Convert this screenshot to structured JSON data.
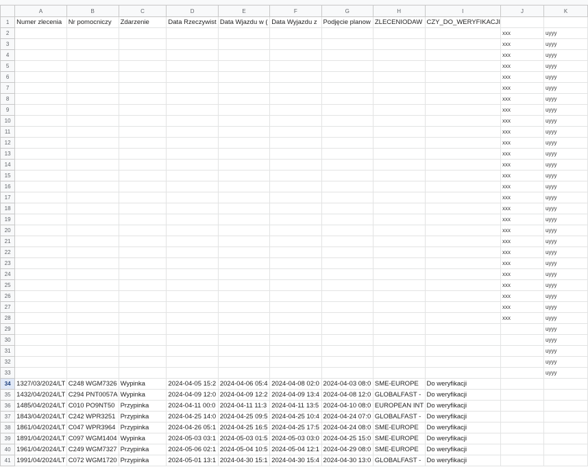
{
  "columns": [
    "A",
    "B",
    "C",
    "D",
    "E",
    "F",
    "G",
    "H",
    "I",
    "J",
    "K"
  ],
  "headers": {
    "A": "Numer zlecenia",
    "B": "Nr pomocniczy",
    "C": "Zdarzenie",
    "D": "Data Rzeczywist",
    "E": "Data Wjazdu w (",
    "F": "Data Wyjazdu z",
    "G": "Podjęcie planow",
    "H": "ZLECENIODAW",
    "I": "CZY_DO_WERYFIKACJI"
  },
  "filler": {
    "j_value": "xxx",
    "k_value": "uyyy"
  },
  "data_rows": [
    {
      "row": 34,
      "A": "1327/03/2024/LT",
      "B": "C248 WGM7326",
      "C": "Wypinka",
      "D": "2024-04-05 15:2",
      "E": "2024-04-06 05:4",
      "F": "2024-04-08 02:0",
      "G": "2024-04-03 08:0",
      "H": "SME-EUROPE",
      "I": "Do weryfikacji"
    },
    {
      "row": 35,
      "A": "1432/04/2024/LT",
      "B": "C294 PNT0057A",
      "C": "Wypinka",
      "D": "2024-04-09 12:0",
      "E": "2024-04-09 12:2",
      "F": "2024-04-09 13:4",
      "G": "2024-04-08 12:0",
      "H": "GLOBALFAST -",
      "I": "Do weryfikacji"
    },
    {
      "row": 36,
      "A": "1485/04/2024/LT",
      "B": "C010 PO9NT50",
      "C": "Przypinka",
      "D": "2024-04-11 00:0",
      "E": "2024-04-11 11:3",
      "F": "2024-04-11 13:5",
      "G": "2024-04-10 08:0",
      "H": "EUROPEAN INT",
      "I": "Do weryfikacji"
    },
    {
      "row": 37,
      "A": "1843/04/2024/LT",
      "B": "C242 WPR3251",
      "C": "Przypinka",
      "D": "2024-04-25 14:0",
      "E": "2024-04-25 09:5",
      "F": "2024-04-25 10:4",
      "G": "2024-04-24 07:0",
      "H": "GLOBALFAST -",
      "I": "Do weryfikacji"
    },
    {
      "row": 38,
      "A": "1861/04/2024/LT",
      "B": "C047 WPR3964",
      "C": "Przypinka",
      "D": "2024-04-26 05:1",
      "E": "2024-04-25 16:5",
      "F": "2024-04-25 17:5",
      "G": "2024-04-24 08:0",
      "H": "SME-EUROPE",
      "I": "Do weryfikacji"
    },
    {
      "row": 39,
      "A": "1891/04/2024/LT",
      "B": "C097 WGM1404",
      "C": "Wypinka",
      "D": "2024-05-03 03:1",
      "E": "2024-05-03 01:5",
      "F": "2024-05-03 03:0",
      "G": "2024-04-25 15:0",
      "H": "SME-EUROPE",
      "I": "Do weryfikacji"
    },
    {
      "row": 40,
      "A": "1961/04/2024/LT",
      "B": "C249 WGM7327",
      "C": "Przypinka",
      "D": "2024-05-06 02:1",
      "E": "2024-05-04 10:5",
      "F": "2024-05-04 12:1",
      "G": "2024-04-29 08:0",
      "H": "SME-EUROPE",
      "I": "Do weryfikacji"
    },
    {
      "row": 41,
      "A": "1991/04/2024/LT",
      "B": "C072 WGM1720",
      "C": "Przypinka",
      "D": "2024-05-01 13:1",
      "E": "2024-04-30 15:1",
      "F": "2024-04-30 15:4",
      "G": "2024-04-30 13:0",
      "H": "GLOBALFAST -",
      "I": "Do weryfikacji"
    }
  ],
  "selected_row": 34
}
